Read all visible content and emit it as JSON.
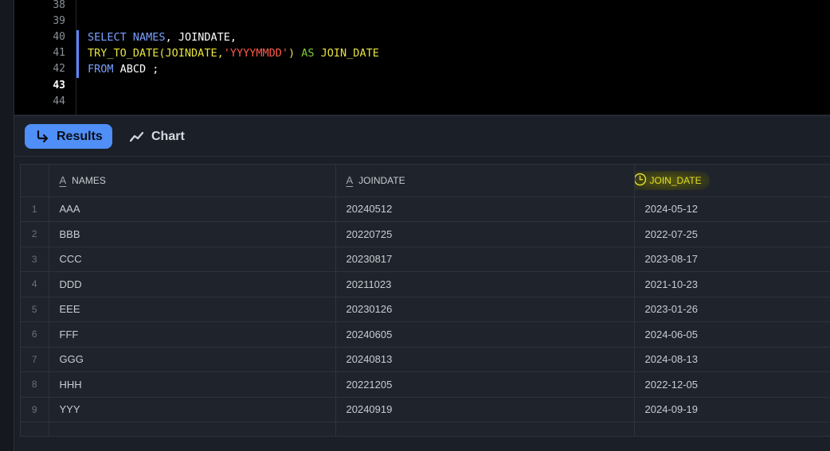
{
  "editor": {
    "line_numbers": [
      "38",
      "39",
      "40",
      "41",
      "42",
      "43",
      "44"
    ],
    "current_line": "43",
    "code": {
      "line40": {
        "kw1": "SELECT",
        "c1": "NAMES",
        "p1": ", JOINDATE,",
        "p1a": ""
      },
      "line41": {
        "fn": "TRY_TO_DATE",
        "p1": "(",
        "arg": "JOINDATE",
        "p2": ",",
        "str": "'YYYYMMDD'",
        "p3": ") ",
        "as": "AS",
        "p4": " ",
        "alias": "JOIN_DATE"
      },
      "line42": {
        "kw": "FROM",
        "rest": " ABCD ;"
      }
    }
  },
  "toolbar": {
    "results_label": "Results",
    "chart_label": "Chart",
    "icons": {
      "results": "return-arrow-icon",
      "chart": "line-chart-icon"
    }
  },
  "grid": {
    "columns": [
      {
        "name": "NAMES",
        "type_icon": "A"
      },
      {
        "name": "JOINDATE",
        "type_icon": "A"
      },
      {
        "name": "JOIN_DATE",
        "type_icon": "clock-icon",
        "highlight_color": "#e3dd2a"
      }
    ],
    "rows": [
      {
        "n": "1",
        "names": "AAA",
        "joindate": "20240512",
        "join_date": "2024-05-12"
      },
      {
        "n": "2",
        "names": "BBB",
        "joindate": "20220725",
        "join_date": "2022-07-25"
      },
      {
        "n": "3",
        "names": "CCC",
        "joindate": "20230817",
        "join_date": "2023-08-17"
      },
      {
        "n": "4",
        "names": "DDD",
        "joindate": "20211023",
        "join_date": "2021-10-23"
      },
      {
        "n": "5",
        "names": "EEE",
        "joindate": "20230126",
        "join_date": "2023-01-26"
      },
      {
        "n": "6",
        "names": "FFF",
        "joindate": "20240605",
        "join_date": "2024-06-05"
      },
      {
        "n": "7",
        "names": "GGG",
        "joindate": "20240813",
        "join_date": "2024-08-13"
      },
      {
        "n": "8",
        "names": "HHH",
        "joindate": "20221205",
        "join_date": "2022-12-05"
      },
      {
        "n": "9",
        "names": "YYY",
        "joindate": "20240919",
        "join_date": "2024-09-19"
      }
    ]
  },
  "colors": {
    "accent": "#4f8ff7",
    "keyword": "#7aa0ff",
    "function": "#e8e33d",
    "string": "#ff5a4a",
    "as_keyword": "#7ecf3c"
  }
}
